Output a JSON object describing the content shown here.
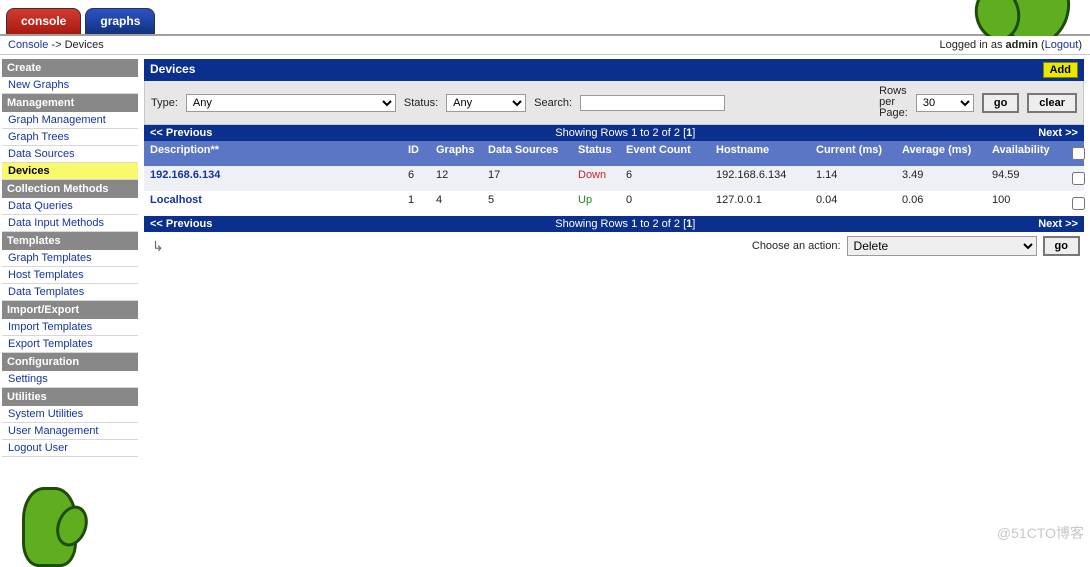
{
  "tabs": {
    "console": "console",
    "graphs": "graphs"
  },
  "breadcrumb": {
    "root": "Console",
    "sep": "->",
    "current": "Devices"
  },
  "login": {
    "prefix": "Logged in as",
    "user": "admin",
    "logout": "Logout"
  },
  "sidebar": {
    "groups": [
      {
        "header": "Create",
        "items": [
          {
            "label": "New Graphs"
          }
        ]
      },
      {
        "header": "Management",
        "items": [
          {
            "label": "Graph Management"
          },
          {
            "label": "Graph Trees"
          },
          {
            "label": "Data Sources"
          },
          {
            "label": "Devices",
            "active": true
          }
        ]
      },
      {
        "header": "Collection Methods",
        "items": [
          {
            "label": "Data Queries"
          },
          {
            "label": "Data Input Methods"
          }
        ]
      },
      {
        "header": "Templates",
        "items": [
          {
            "label": "Graph Templates"
          },
          {
            "label": "Host Templates"
          },
          {
            "label": "Data Templates"
          }
        ]
      },
      {
        "header": "Import/Export",
        "items": [
          {
            "label": "Import Templates"
          },
          {
            "label": "Export Templates"
          }
        ]
      },
      {
        "header": "Configuration",
        "items": [
          {
            "label": "Settings"
          }
        ]
      },
      {
        "header": "Utilities",
        "items": [
          {
            "label": "System Utilities"
          },
          {
            "label": "User Management"
          },
          {
            "label": "Logout User"
          }
        ]
      }
    ]
  },
  "pane": {
    "title": "Devices",
    "add": "Add"
  },
  "filters": {
    "type_label": "Type:",
    "type_value": "Any",
    "status_label": "Status:",
    "status_value": "Any",
    "search_label": "Search:",
    "search_value": "",
    "rows_label_a": "Rows",
    "rows_label_b": "per",
    "rows_label_c": "Page:",
    "rows_value": "30",
    "go": "go",
    "clear": "clear"
  },
  "pager": {
    "prev": "<< Previous",
    "mid_a": "Showing Rows 1 to 2 of 2 [",
    "mid_b": "1",
    "mid_c": "]",
    "next": "Next >>"
  },
  "columns": {
    "desc": "Description**",
    "id": "ID",
    "graphs": "Graphs",
    "ds": "Data Sources",
    "status": "Status",
    "evt": "Event Count",
    "host": "Hostname",
    "cur": "Current (ms)",
    "avg": "Average (ms)",
    "avail": "Availability"
  },
  "rows": [
    {
      "desc": "192.168.6.134",
      "id": "6",
      "graphs": "12",
      "ds": "17",
      "status": "Down",
      "status_class": "down",
      "evt": "6",
      "host": "192.168.6.134",
      "cur": "1.14",
      "avg": "3.49",
      "avail": "94.59"
    },
    {
      "desc": "Localhost",
      "id": "1",
      "graphs": "4",
      "ds": "5",
      "status": "Up",
      "status_class": "up",
      "evt": "0",
      "host": "127.0.0.1",
      "cur": "0.04",
      "avg": "0.06",
      "avail": "100"
    }
  ],
  "action": {
    "label": "Choose an action:",
    "value": "Delete",
    "go": "go"
  },
  "watermark": "@51CTO博客"
}
